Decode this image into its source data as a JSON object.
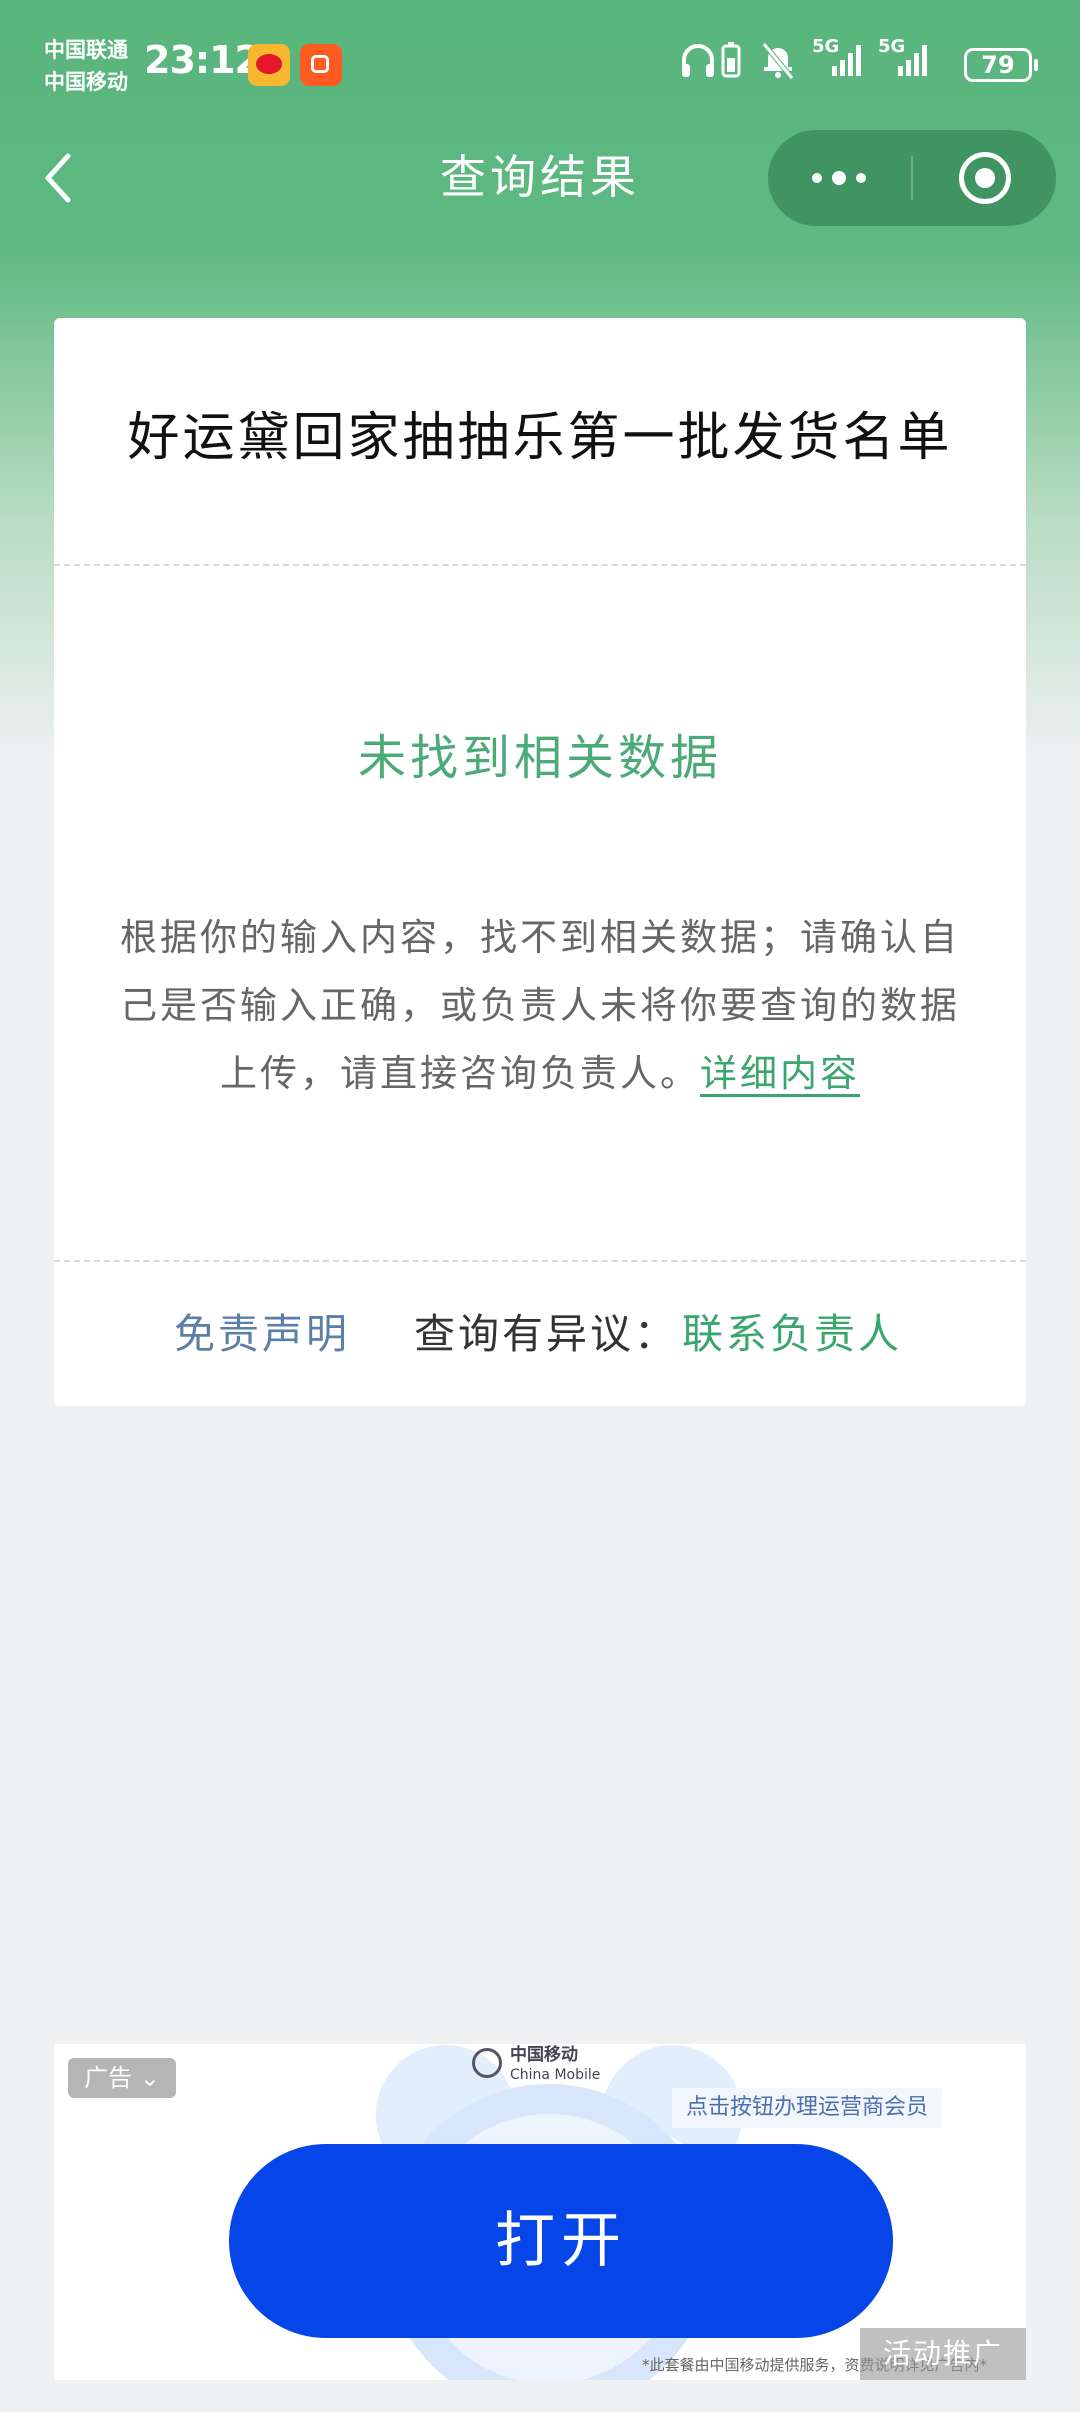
{
  "status_bar": {
    "carrier_1": "中国联通",
    "carrier_2": "中国移动",
    "time": "23:12",
    "network_1": "5G",
    "network_2": "5G",
    "battery": "79",
    "icons": [
      "weibo-app-icon",
      "kuaishou-app-icon",
      "headphones-icon",
      "battery-saver-icon",
      "mute-bell-icon",
      "signal-icon",
      "signal-icon",
      "battery-icon"
    ]
  },
  "nav": {
    "title": "查询结果",
    "back_icon": "chevron-left-icon",
    "more_icon": "more-dots-icon",
    "close_icon": "target-close-icon"
  },
  "card": {
    "title": "好运黛回家抽抽乐第一批发货名单",
    "empty_heading": "未找到相关数据",
    "empty_description": "根据你的输入内容，找不到相关数据；请确认自己是否输入正确，或负责人未将你要查询的数据上传，请直接咨询负责人。",
    "detail_link": "详细内容",
    "disclaimer": "免责声明",
    "objection_label": "查询有异议：",
    "contact_link": "联系负责人"
  },
  "ad": {
    "tag": "广告",
    "brand_cn": "中国移动",
    "brand_en": "China Mobile",
    "cta_text": "点击按钮办理运营商会员",
    "open_button": "打开",
    "promo_label": "活动推广",
    "fine_print": "*此套餐由中国移动提供服务，资费说明详见广告内*"
  },
  "colors": {
    "header_green": "#58b57c",
    "accent_green": "#4caa78",
    "link_blue": "#5b7fa6",
    "ad_button_blue": "#0646e8"
  }
}
